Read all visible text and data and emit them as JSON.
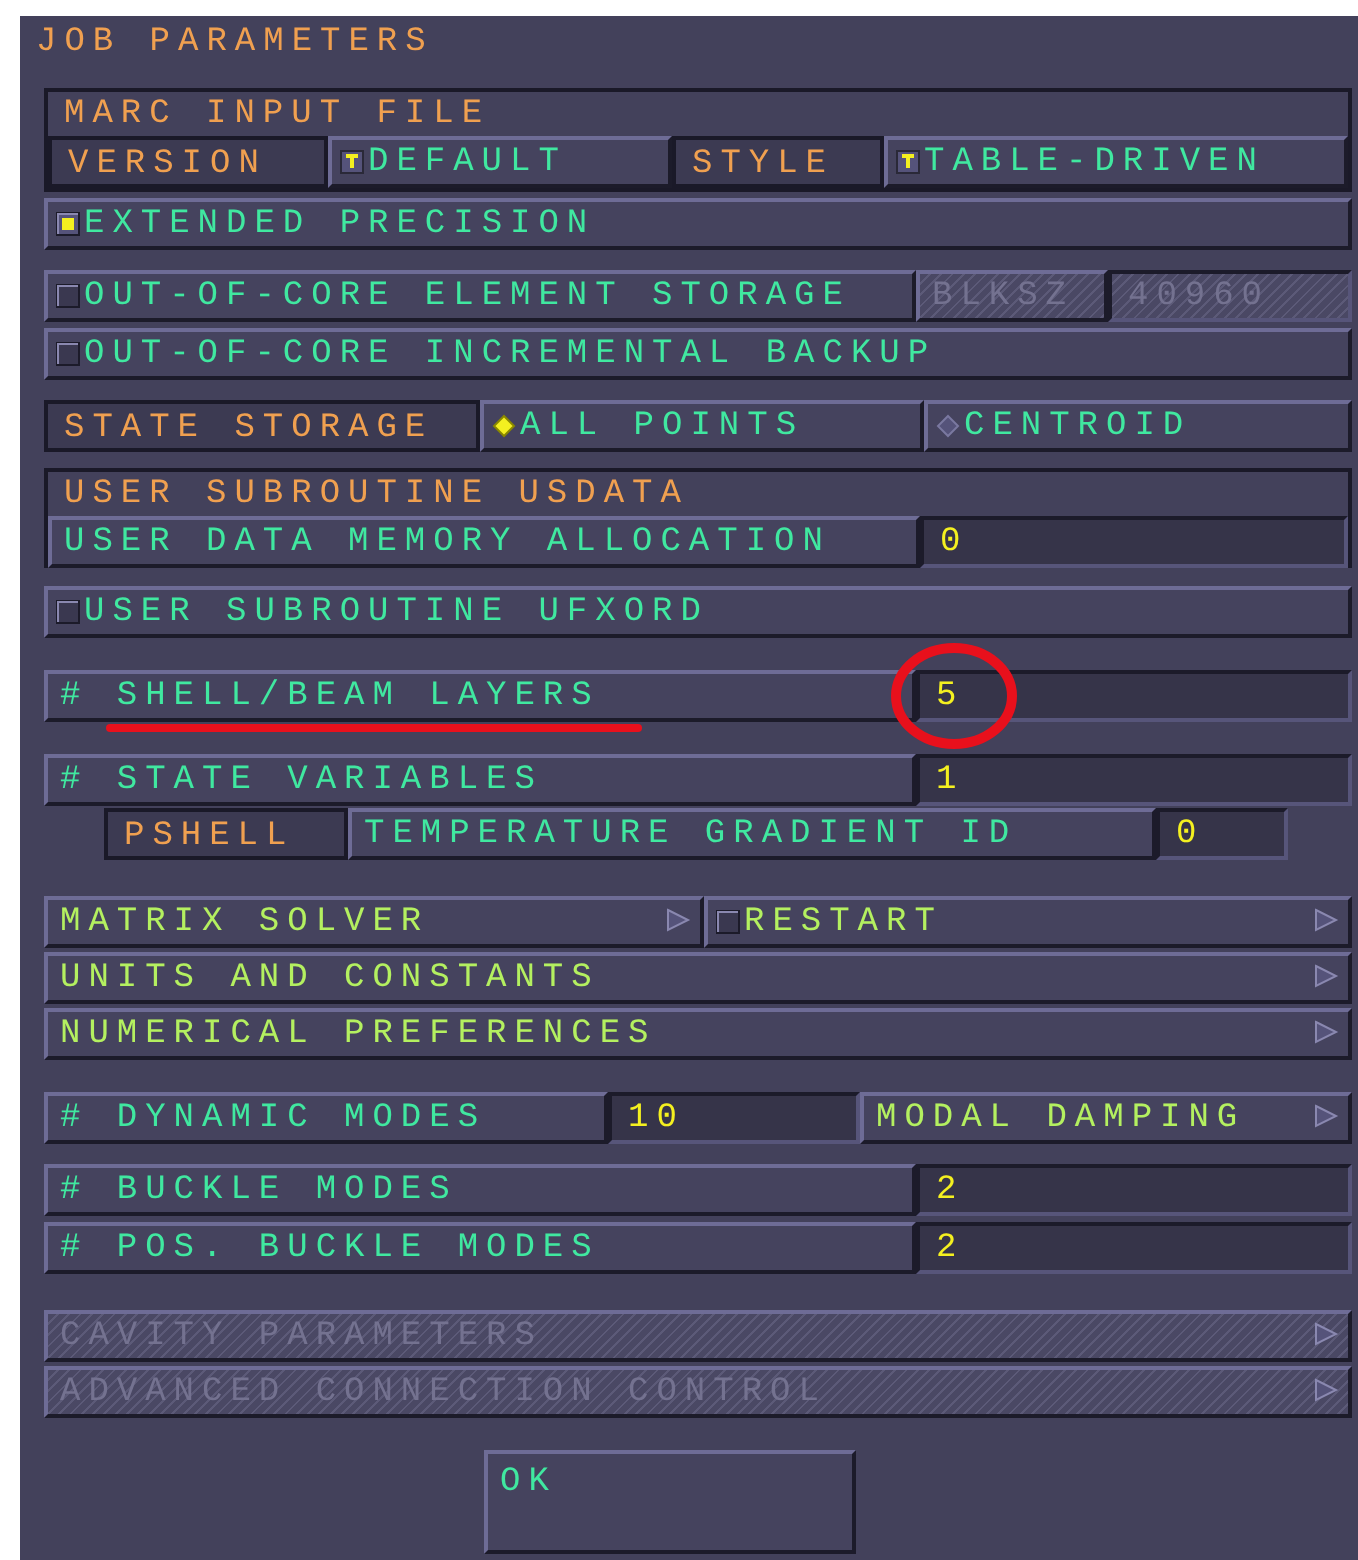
{
  "title": "JOB PARAMETERS",
  "marc_input_file": {
    "heading": "MARC INPUT FILE",
    "version": {
      "label": "VERSION",
      "value": "DEFAULT"
    },
    "style": {
      "label": "STYLE",
      "value": "TABLE-DRIVEN"
    }
  },
  "extended_precision": {
    "label": "EXTENDED PRECISION",
    "checked": true
  },
  "out_of_core_element_storage": {
    "label": "OUT-OF-CORE ELEMENT STORAGE",
    "checked": false,
    "blksz": {
      "label": "BLKSZ",
      "value": "40960",
      "disabled": true
    }
  },
  "out_of_core_incremental_backup": {
    "label": "OUT-OF-CORE INCREMENTAL BACKUP",
    "checked": false
  },
  "state_storage": {
    "label": "STATE STORAGE",
    "options": [
      {
        "label": "ALL POINTS",
        "selected": true
      },
      {
        "label": "CENTROID",
        "selected": false
      }
    ]
  },
  "user_subroutine_usdata": {
    "heading": "USER SUBROUTINE USDATA",
    "memory": {
      "label": "USER DATA MEMORY ALLOCATION",
      "value": "0"
    }
  },
  "user_subroutine_ufxord": {
    "label": "USER SUBROUTINE UFXORD",
    "checked": false
  },
  "shell_beam_layers": {
    "label": "# SHELL/BEAM LAYERS",
    "value": "5",
    "highlighted": true
  },
  "state_variables": {
    "label": "# STATE VARIABLES",
    "value": "1"
  },
  "pshell": {
    "label": "PSHELL",
    "temperature_gradient_id": {
      "label": "TEMPERATURE GRADIENT ID",
      "value": "0"
    }
  },
  "menu_rows": [
    [
      {
        "label": "MATRIX SOLVER",
        "disabled": false
      },
      {
        "label": "RESTART",
        "checked": false,
        "disabled": false
      }
    ],
    [
      {
        "label": "UNITS AND CONSTANTS",
        "disabled": false
      }
    ],
    [
      {
        "label": "NUMERICAL PREFERENCES",
        "disabled": false
      }
    ]
  ],
  "dynamic_modes": {
    "label": "# DYNAMIC MODES",
    "value": "10",
    "damping": {
      "label": "MODAL DAMPING",
      "disabled": false
    }
  },
  "buckle": [
    {
      "label": "# BUCKLE MODES",
      "value": "2"
    },
    {
      "label": "# POS. BUCKLE MODES",
      "value": "2"
    }
  ],
  "advanced_menus": [
    {
      "label": "CAVITY PARAMETERS",
      "disabled": true
    },
    {
      "label": "ADVANCED CONNECTION CONTROL",
      "disabled": true
    }
  ],
  "ok": "OK"
}
